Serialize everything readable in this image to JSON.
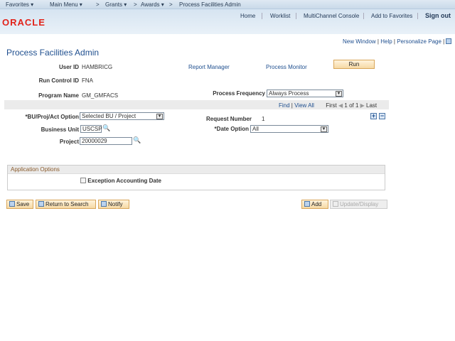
{
  "nav": {
    "favorites": "Favorites ▾",
    "main_menu": "Main Menu ▾",
    "sep": ">",
    "grants": "Grants ▾",
    "awards": "Awards ▾",
    "current": "Process Facilities Admin"
  },
  "header": {
    "logo": "ORACLE",
    "links": [
      "Home",
      "Worklist",
      "MultiChannel Console",
      "Add to Favorites",
      "Sign out"
    ]
  },
  "pagebar": {
    "new_window": "New Window",
    "help": "Help",
    "personalize": "Personalize Page"
  },
  "page_title": "Process Facilities Admin",
  "form": {
    "user_id_label": "User ID",
    "user_id": "HAMBRICG",
    "run_control_label": "Run Control ID",
    "run_control": "FNA",
    "program_label": "Program Name",
    "program": "GM_GMFACS",
    "report_manager": "Report Manager",
    "process_monitor": "Process Monitor",
    "run": "Run",
    "freq_label": "Process Frequency",
    "freq": "Always Process",
    "grid": {
      "find": "Find",
      "view_all": "View All",
      "first": "First",
      "count": "1 of 1",
      "last": "Last"
    },
    "bu_opt_label": "*BU/Proj/Act Option",
    "bu_opt": "Selected BU / Project",
    "req_label": "Request Number",
    "req": "1",
    "bu_label": "Business Unit",
    "bu": "USCSP",
    "date_label": "*Date Option",
    "date": "All",
    "project_label": "Project",
    "project": "20000029"
  },
  "app_options": {
    "title": "Application Options",
    "checkbox_label": "Exception Accounting Date",
    "checked": false
  },
  "buttons": {
    "save": "Save",
    "return": "Return to Search",
    "notify": "Notify",
    "add": "Add",
    "update": "Update/Display"
  }
}
